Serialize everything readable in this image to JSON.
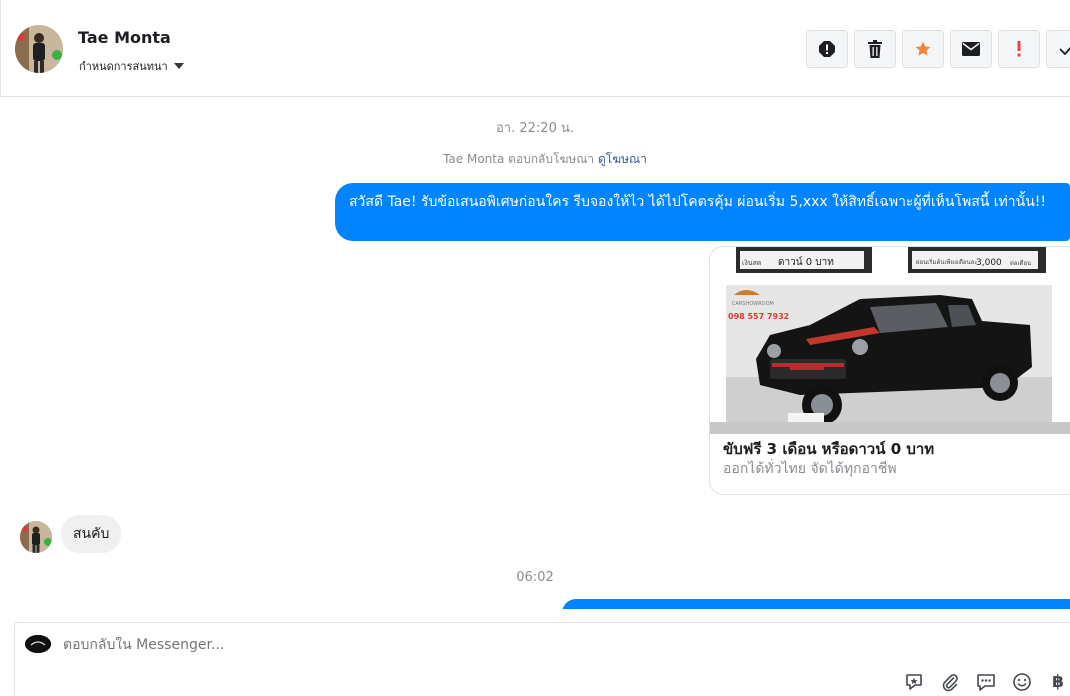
{
  "header": {
    "name": "Tae Monta",
    "settings_label": "กำหนดการสนทนา",
    "toolbar": [
      {
        "name": "spam-alert-icon",
        "color": "#1c1e21"
      },
      {
        "name": "trash-icon",
        "color": "#1c1e21"
      },
      {
        "name": "star-icon",
        "color": "#f0873a"
      },
      {
        "name": "envelope-icon",
        "color": "#1c1e21"
      },
      {
        "name": "exclamation-icon",
        "color": "#fa3e3e"
      },
      {
        "name": "check-icon",
        "color": "#1c1e21"
      }
    ]
  },
  "messages": {
    "timestamp_1": "อา. 22:20 น.",
    "ad_reply_text": "Tae Monta ตอบกลับโฆษณา",
    "ad_reply_link": "ดูโฆษณา",
    "outgoing_1": "สวัสดี Tae! รับข้อเสนอพิเศษก่อนใคร รีบจองให้ไว ได้ไปโคตรคุ้ม ผ่อนเริ่ม 5,xxx  ให้สิทธิ์เฉพาะผู้ที่เห็นโพสนี้ เท่านั้น!!",
    "ad_card": {
      "image_labels": {
        "down_payment": "ดาวน์ 0 บาท",
        "installment": "3,000",
        "phone": "098 557 7932"
      },
      "title": "ขับฟรี 3 เดือน หรือดาวน์ 0 บาท",
      "subtitle": "ออกได้ทั่วไทย จัดได้ทุกอาชีพ"
    },
    "incoming_1": "สนคับ",
    "timestamp_2": "06:02"
  },
  "composer": {
    "placeholder": "ตอบกลับใน Messenger...",
    "actions": [
      "sticker-icon",
      "attachment-icon",
      "saved-replies-icon",
      "emoji-icon",
      "baht-icon"
    ],
    "baht_symbol": "฿"
  },
  "colors": {
    "accent": "#0084ff",
    "incoming_bubble": "#f1f0f0",
    "muted": "#8a8d91",
    "link": "#385898"
  }
}
